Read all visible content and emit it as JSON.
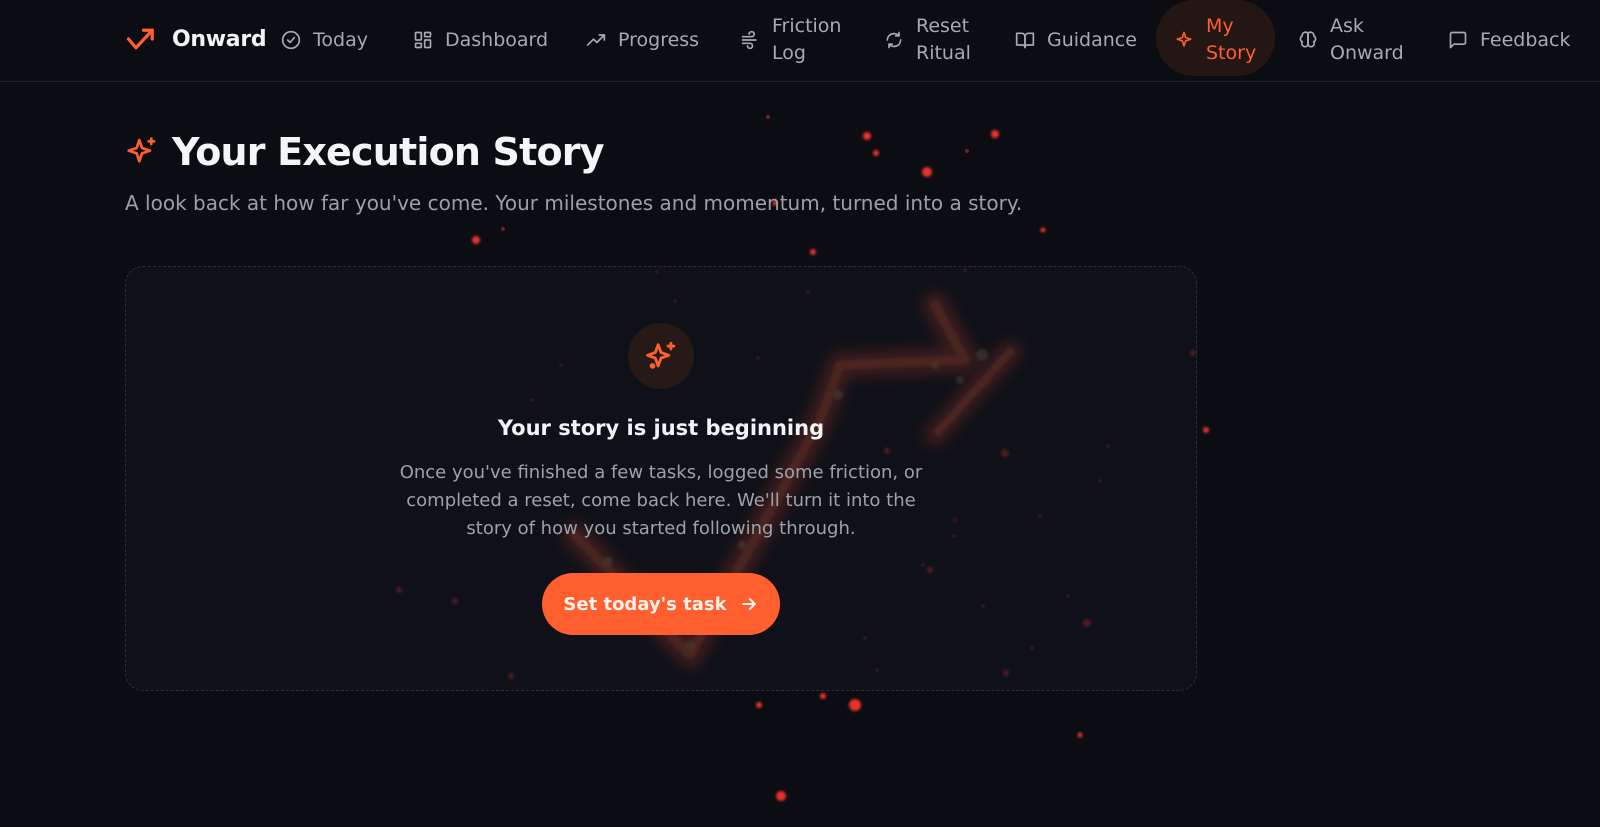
{
  "brand": {
    "name": "Onward"
  },
  "nav": {
    "today": "Today",
    "dashboard": "Dashboard",
    "progress": "Progress",
    "friction_log": "Friction Log",
    "reset_ritual": "Reset Ritual",
    "guidance": "Guidance",
    "my_story": "My Story",
    "ask_onward": "Ask Onward",
    "feedback": "Feedback",
    "active": "My Story"
  },
  "page": {
    "title": "Your Execution Story",
    "subtitle": "A look back at how far you've come. Your milestones and momentum, turned into a story."
  },
  "empty_state": {
    "title": "Your story is just beginning",
    "body": "Once you've finished a few tasks, logged some friction, or completed a reset, come back here. We'll turn it into the story of how you started following through.",
    "cta_label": "Set today's task"
  },
  "colors": {
    "accent": "#ff5f2e",
    "background": "#0b0d12",
    "card": "#12141b",
    "muted_text": "#9aa0aa"
  },
  "icons": {
    "brand": "trending-up-arrow-icon",
    "today": "check-circle-icon",
    "dashboard": "grid-icon",
    "progress": "trending-up-icon",
    "friction_log": "wind-icon",
    "reset_ritual": "refresh-icon",
    "guidance": "open-book-icon",
    "my_story": "sparkles-icon",
    "ask_onward": "brain-icon",
    "feedback": "message-square-icon",
    "cta": "arrow-right-icon"
  }
}
